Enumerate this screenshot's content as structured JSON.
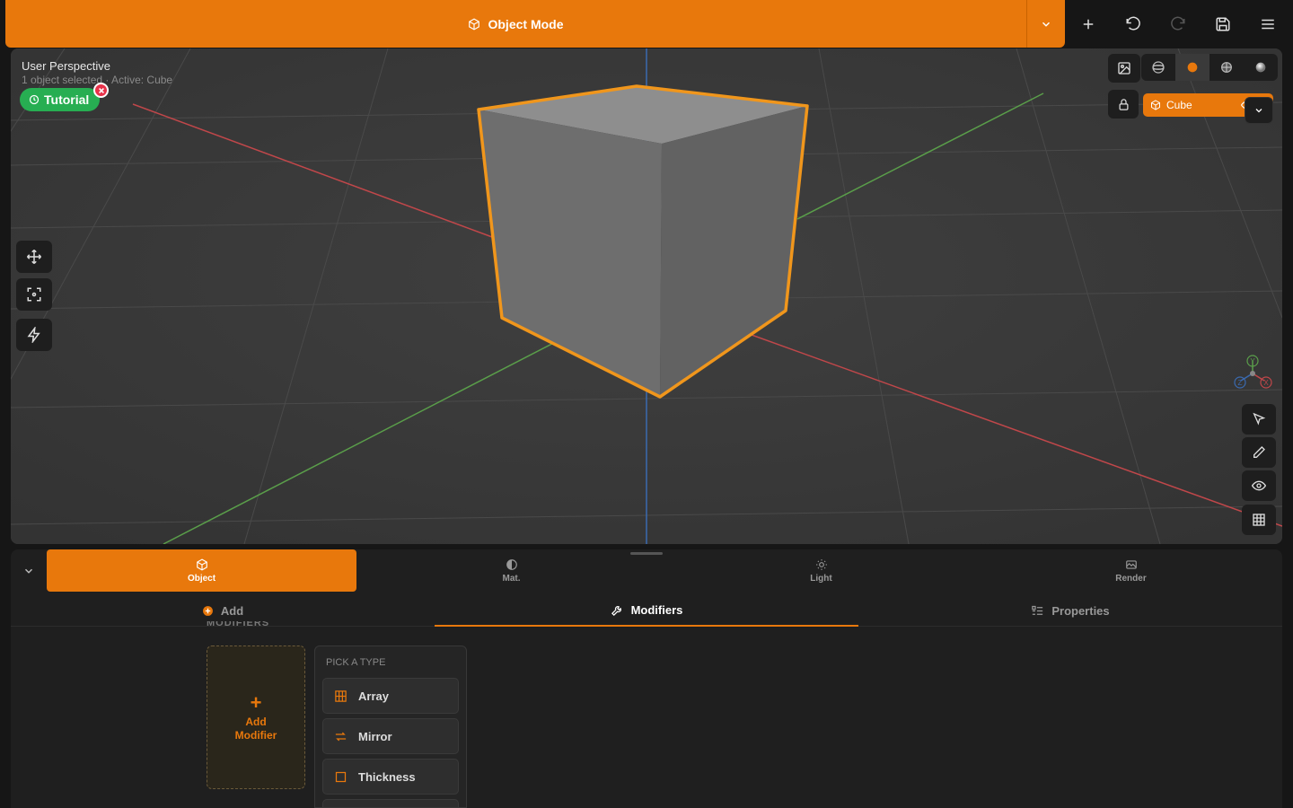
{
  "header": {
    "mode_label": "Object Mode"
  },
  "viewport": {
    "title": "User Perspective",
    "subtitle": "1 object selected · Active: Cube",
    "tutorial_label": "Tutorial",
    "active_object": "Cube",
    "gizmo": {
      "x": "X",
      "y": "Y",
      "z": "Z"
    }
  },
  "panel": {
    "categories": [
      {
        "label": "Object"
      },
      {
        "label": "Mat."
      },
      {
        "label": "Light"
      },
      {
        "label": "Render"
      }
    ],
    "subtabs": {
      "add": "Add",
      "modifiers": "Modifiers",
      "properties": "Properties"
    },
    "section_label": "MODIFIERS",
    "add_modifier": "Add Modifier",
    "picker": {
      "title": "PICK A TYPE",
      "types": [
        "Array",
        "Mirror",
        "Thickness"
      ]
    }
  },
  "colors": {
    "accent": "#e8780c",
    "tutorial": "#27ae52",
    "axis_x": "#c0474a",
    "axis_y": "#5a9e4a",
    "axis_z": "#3a6ab0"
  }
}
